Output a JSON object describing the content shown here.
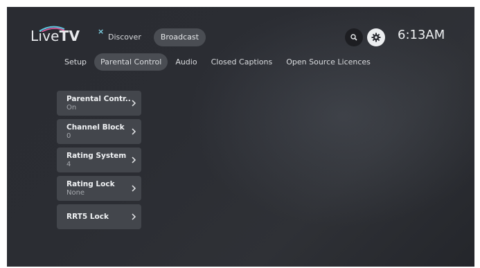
{
  "brand": {
    "name_light": "Live",
    "name_bold": "TV",
    "mark": "×"
  },
  "top_nav": {
    "tabs": [
      {
        "label": "Discover",
        "active": false
      },
      {
        "label": "Broadcast",
        "active": true
      }
    ]
  },
  "header": {
    "search_icon": "search-icon",
    "settings_icon": "gear-icon",
    "clock": "6:13AM"
  },
  "settings_nav": {
    "tabs": [
      {
        "label": "Setup",
        "active": false
      },
      {
        "label": "Parental Control",
        "active": true
      },
      {
        "label": "Audio",
        "active": false
      },
      {
        "label": "Closed Captions",
        "active": false
      },
      {
        "label": "Open Source Licences",
        "active": false
      }
    ]
  },
  "menu": {
    "items": [
      {
        "label": "Parental Contr..",
        "value": "On"
      },
      {
        "label": "Channel Block",
        "value": "0"
      },
      {
        "label": "Rating System",
        "value": "4"
      },
      {
        "label": "Rating Lock",
        "value": "None"
      },
      {
        "label": "RRT5 Lock",
        "value": ""
      }
    ]
  },
  "colors": {
    "background": "#2b2d33",
    "card": "#43464c",
    "active_pill": "#4a4d53",
    "text": "#eef0f2",
    "muted_text": "#a6a9ae",
    "logo_accent": "#7fd3e6"
  }
}
